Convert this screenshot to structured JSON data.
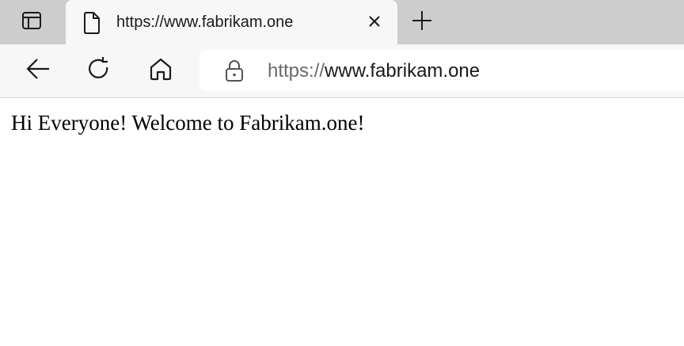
{
  "tab": {
    "title": "https://www.fabrikam.one"
  },
  "address_bar": {
    "url_scheme": "https://",
    "url_host": "www.fabrikam.one"
  },
  "page": {
    "text": "Hi Everyone! Welcome to Fabrikam.one!"
  },
  "icons": {
    "tab_actions": "tab-actions-icon",
    "favicon": "page-icon",
    "close": "close-icon",
    "new_tab": "plus-icon",
    "back": "arrow-left-icon",
    "refresh": "refresh-icon",
    "home": "home-icon",
    "lock": "lock-icon"
  },
  "colors": {
    "tab_strip": "#cdcdcd",
    "active_tab": "#f7f7f7",
    "toolbar": "#f7f7f7",
    "address_bar": "#ffffff",
    "url_scheme": "#6a6a6a",
    "url_host": "#1a1a1a"
  }
}
